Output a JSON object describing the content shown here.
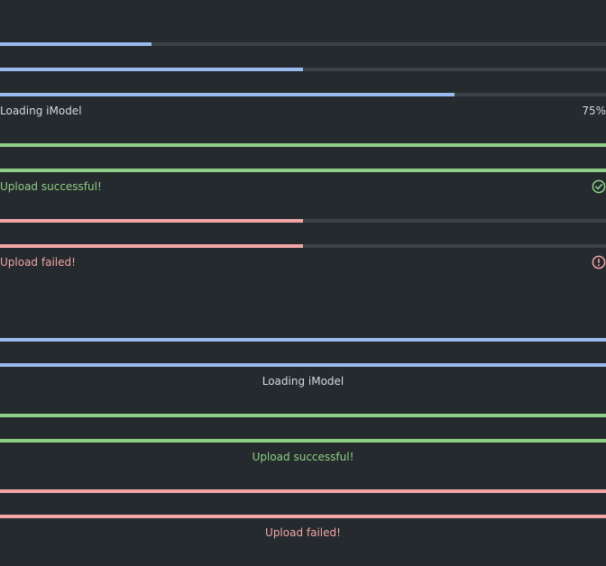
{
  "colors": {
    "background": "#252a2e",
    "track": "#3b4246",
    "informational": "#99bbf0",
    "positive": "#8fcf86",
    "negative": "#f2a5a5",
    "text": "#d6dadd"
  },
  "left_aligned": {
    "determinate_bars": [
      {
        "value": 0.25,
        "status": "informational"
      },
      {
        "value": 0.5,
        "status": "informational"
      },
      {
        "value": 0.75,
        "status": "informational"
      }
    ],
    "loading": {
      "label": "Loading iModel",
      "value_text": "75%"
    },
    "positive_bars": [
      {
        "value": 1.0,
        "status": "positive"
      },
      {
        "value": 1.0,
        "status": "positive"
      }
    ],
    "success": {
      "label": "Upload successful!",
      "icon": "checkmark-circle-icon"
    },
    "negative_bars": [
      {
        "value": 0.5,
        "status": "negative"
      },
      {
        "value": 0.5,
        "status": "negative"
      }
    ],
    "failure": {
      "label": "Upload failed!",
      "icon": "status-error-icon"
    }
  },
  "centered": {
    "informational_bars": [
      {
        "value": 1.0,
        "status": "informational"
      },
      {
        "value": 1.0,
        "status": "informational"
      }
    ],
    "loading_label": "Loading iModel",
    "positive_bars": [
      {
        "value": 1.0,
        "status": "positive"
      },
      {
        "value": 1.0,
        "status": "positive"
      }
    ],
    "success_label": "Upload successful!",
    "negative_bars": [
      {
        "value": 1.0,
        "status": "negative"
      },
      {
        "value": 1.0,
        "status": "negative"
      }
    ],
    "failure_label": "Upload failed!"
  }
}
